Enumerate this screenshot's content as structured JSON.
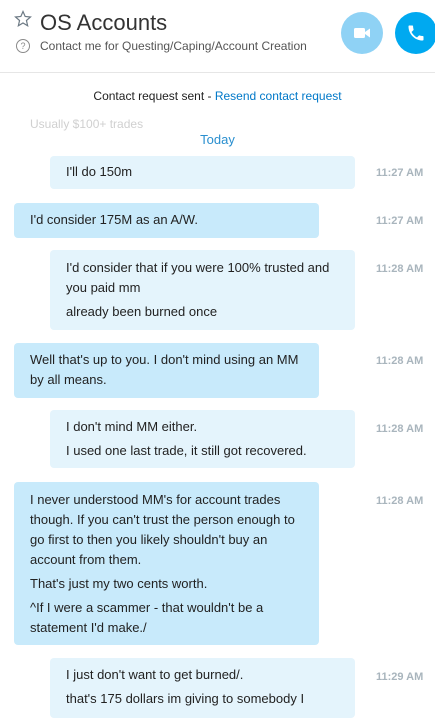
{
  "header": {
    "title": "OS Accounts",
    "mood": "Contact me for Questing/Caping/Account Creation"
  },
  "request_bar": {
    "text": "Contact request sent - ",
    "link": "Resend contact request"
  },
  "ghost_text": "Usually $100+ trades",
  "date_divider": "Today",
  "messages": [
    {
      "lines": [
        "I'll do 150m"
      ],
      "time": "11:27 AM"
    },
    {
      "lines": [
        "I'd consider 175M as an A/W."
      ],
      "time": "11:27 AM"
    },
    {
      "lines": [
        "I'd consider that if you were 100% trusted and you paid mm",
        "already been burned once"
      ],
      "time": "11:28 AM"
    },
    {
      "lines": [
        "Well that's up to you. I don't mind using an MM by all means."
      ],
      "time": "11:28 AM"
    },
    {
      "lines": [
        "I don't mind MM either.",
        "I used one last trade, it still got recovered."
      ],
      "time": "11:28 AM"
    },
    {
      "lines": [
        "I never understood MM's for account trades though. If you can't trust the person enough to go first to then you likely shouldn't buy an account from them.",
        "That's just my two cents worth.",
        "^If I were a scammer - that wouldn't be a statement I'd make./"
      ],
      "time": "11:28 AM"
    },
    {
      "lines": [
        "I just don't want to get burned/.",
        "that's 175 dollars im giving to somebody I"
      ],
      "time": "11:29 AM"
    }
  ]
}
